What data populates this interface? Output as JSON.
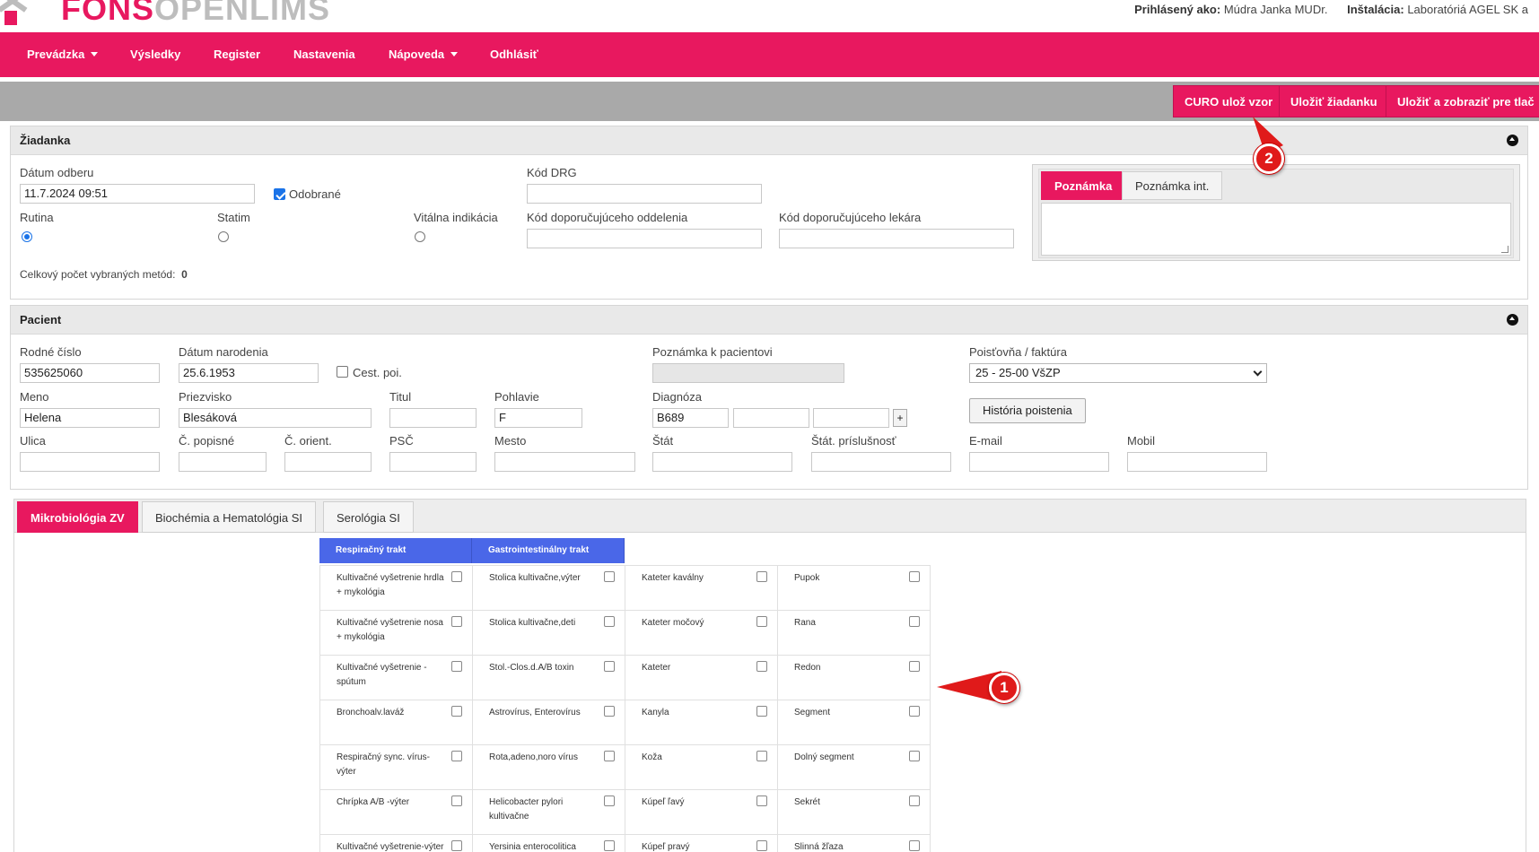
{
  "header": {
    "brand_primary": "FONS",
    "brand_secondary": "OPENLIMS",
    "user_label": "Prihlásený ako:",
    "user_name": "Múdra Janka MUDr.",
    "install_label": "Inštalácia:",
    "install_name": "Laboratóriá AGEL SK a"
  },
  "nav": {
    "items": [
      {
        "label": "Prevádzka",
        "dropdown": true
      },
      {
        "label": "Výsledky"
      },
      {
        "label": "Register"
      },
      {
        "label": "Nastavenia"
      },
      {
        "label": "Nápoveda",
        "dropdown": true
      },
      {
        "label": "Odhlásiť"
      }
    ]
  },
  "toolbar": {
    "curo_label": "CURO ulož vzor",
    "save_label": "Uložiť žiadanku",
    "save_print_label": "Uložiť a zobraziť pre tlač"
  },
  "request": {
    "title": "Žiadanka",
    "date_label": "Dátum odberu",
    "date_value": "11.7.2024 09:51",
    "collected_label": "Odobrané",
    "routine_label": "Rutina",
    "statim_label": "Statim",
    "vital_label": "Vitálna indikácia",
    "drg_label": "Kód DRG",
    "dept_code_label": "Kód doporučujúceho oddelenia",
    "doctor_code_label": "Kód doporučujúceho lekára",
    "total_label": "Celkový počet vybraných metód:",
    "total_value": "0",
    "note_tab": "Poznámka",
    "note_int_tab": "Poznámka int."
  },
  "patient": {
    "title": "Pacient",
    "birth_no_label": "Rodné číslo",
    "birth_no_value": "535625060",
    "birth_date_label": "Dátum narodenia",
    "birth_date_value": "25.6.1953",
    "foreign_label": "Cest. poi.",
    "patient_note_label": "Poznámka k pacientovi",
    "insurance_label": "Poisťovňa / faktúra",
    "insurance_value": "25 - 25-00 VšZP",
    "first_name_label": "Meno",
    "first_name_value": "Helena",
    "last_name_label": "Priezvisko",
    "last_name_value": "Blesáková",
    "title_label": "Titul",
    "sex_label": "Pohlavie",
    "sex_value": "F",
    "diagnosis_label": "Diagnóza",
    "diagnosis_value": "B689",
    "plus": "+",
    "history_btn": "História poistenia",
    "street_label": "Ulica",
    "house_no_label": "Č. popisné",
    "orient_no_label": "Č. orient.",
    "zip_label": "PSČ",
    "city_label": "Mesto",
    "state_label": "Štát",
    "citizenship_label": "Štát. príslušnosť",
    "email_label": "E-mail",
    "mobile_label": "Mobil"
  },
  "method_tabs": [
    "Mikrobiológia ZV",
    "Biochémia a Hematológia SI",
    "Serológia SI"
  ],
  "methods": {
    "group_headers": [
      "Respiračný trakt",
      "Gastrointestinálny trakt"
    ],
    "rows": [
      [
        "Kultivačné vyšetrenie hrdla + mykológia",
        "Stolica kultivačne,výter",
        "Kateter kaválny",
        "Pupok"
      ],
      [
        "Kultivačné vyšetrenie nosa + mykológia",
        "Stolica kultivačne,deti",
        "Kateter močový",
        "Rana"
      ],
      [
        "Kultivačné vyšetrenie - spútum",
        "Stol.-Clos.d.A/B toxin",
        "Kateter",
        "Redon"
      ],
      [
        "Bronchoalv.laváž",
        "Astrovírus, Enterovírus",
        "Kanyla",
        "Segment"
      ],
      [
        "Respiračný sync. vírus-výter",
        "Rota,adeno,noro vírus",
        "Koža",
        "Dolný segment"
      ],
      [
        "Chrípka A/B -výter",
        "Helicobacter pylori kultivačne",
        "Kúpeľ ľavý",
        "Sekrét"
      ],
      [
        "Kultivačné vyšetrenie-výter",
        "Yersinia enterocolitica",
        "Kúpeľ pravý",
        "Slinná žľaza"
      ]
    ]
  },
  "annotations": {
    "badge1": "1",
    "badge2": "2"
  },
  "colors": {
    "brand": "#e8185f",
    "group_header": "#4a67e8",
    "annotation": "#e01a1a"
  }
}
